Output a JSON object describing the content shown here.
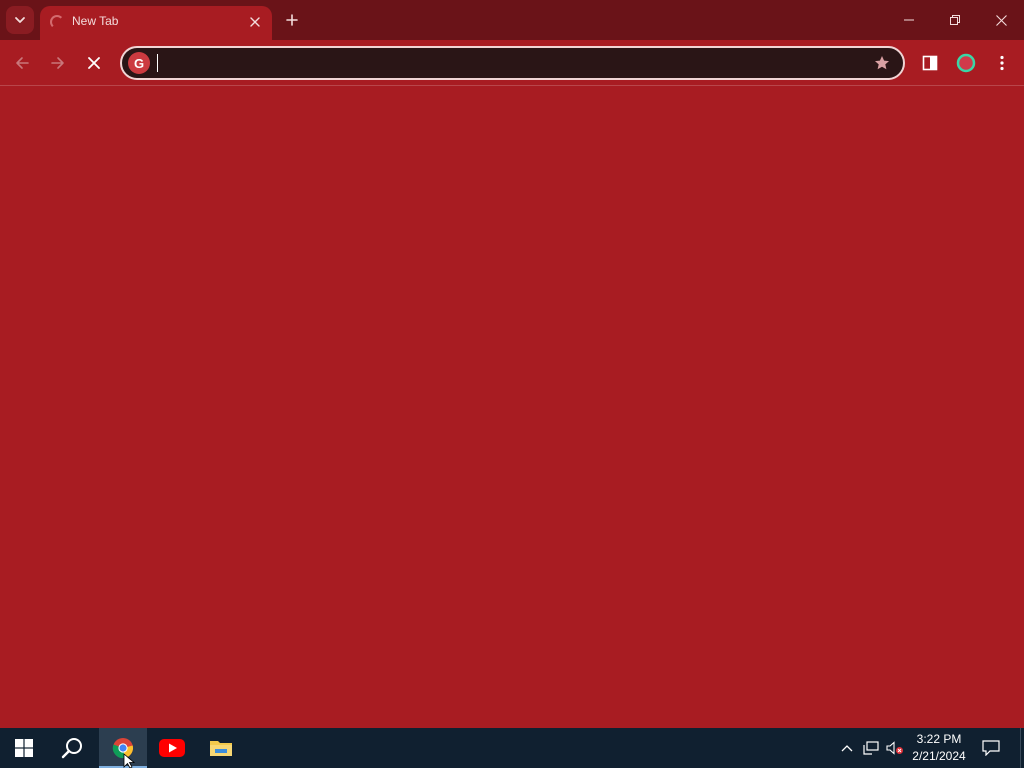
{
  "browser": {
    "tabs": [
      {
        "title": "New Tab",
        "loading": true
      }
    ],
    "omnibox": {
      "value": "",
      "placeholder": ""
    },
    "theme": {
      "frame": "#6a1318",
      "toolbar": "#a81c22",
      "content": "#a81c22"
    },
    "icons": {
      "tab_search": "chevron-down-icon",
      "tab_close": "close-icon",
      "new_tab": "plus-icon",
      "back": "arrow-left-icon",
      "forward": "arrow-right-icon",
      "stop": "close-icon",
      "search_engine": "google-g-icon",
      "bookmark": "star-icon",
      "side_panel": "side-panel-icon",
      "profile": "profile-avatar-icon",
      "menu": "kebab-menu-icon"
    },
    "window_controls": [
      "minimize-icon",
      "restore-icon",
      "close-icon"
    ]
  },
  "taskbar": {
    "pinned": [
      {
        "name": "start",
        "icon": "windows-logo-icon"
      },
      {
        "name": "search",
        "icon": "search-icon"
      },
      {
        "name": "chrome",
        "icon": "chrome-icon",
        "active": true
      },
      {
        "name": "youtube",
        "icon": "youtube-icon"
      },
      {
        "name": "file-explorer",
        "icon": "folder-icon"
      }
    ],
    "tray": {
      "icons": [
        "chevron-up-icon",
        "network-icon",
        "volume-muted-icon"
      ],
      "time": "3:22 PM",
      "date": "2/21/2024",
      "notification_icon": "notification-icon"
    }
  }
}
